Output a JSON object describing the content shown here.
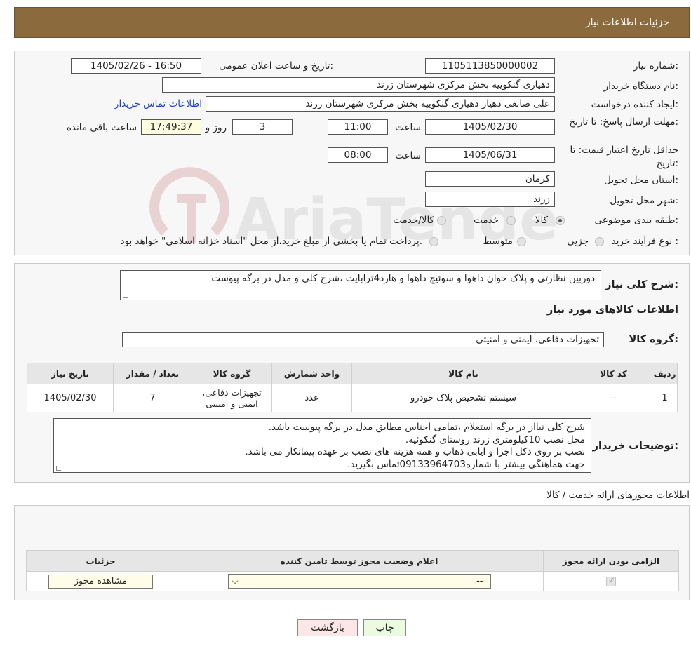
{
  "header": {
    "title": "جزئیات اطلاعات نیاز"
  },
  "form": {
    "need_number_label": "شماره نیاز:",
    "need_number": "1105113850000002",
    "announce_label": "تاریخ و ساعت اعلان عمومی:",
    "announce_value": "1405/02/26 - 16:50",
    "buyer_org_label": "نام دستگاه خریدار:",
    "buyer_org": "دهیاری گنکوییه بخش مرکزی شهرستان زرند",
    "requester_label": "ایجاد کننده درخواست:",
    "requester": "علی صانعی دهیار دهیاری گنکوییه بخش مرکزی شهرستان زرند",
    "contact_link": "اطلاعات تماس خریدار",
    "reply_deadline_label": "مهلت ارسال پاسخ: تا تاریخ:",
    "reply_date": "1405/02/30",
    "time_label": "ساعت",
    "reply_time": "11:00",
    "days_value": "3",
    "days_label": "روز و",
    "remaining_time": "17:49:37",
    "remaining_label": "ساعت باقی مانده",
    "price_validity_label": "حداقل تاریخ اعتبار قیمت: تا تاریخ:",
    "price_date": "1405/06/31",
    "price_time": "08:00",
    "province_label": "استان محل تحویل:",
    "province": "کرمان",
    "city_label": "شهر محل تحویل:",
    "city": "زرند",
    "category_label": "طبقه بندی موضوعی:",
    "category_options": [
      "کالا",
      "خدمت",
      "کالا/خدمت"
    ],
    "category_selected": "کالا",
    "process_label": "نوع فرآیند خرید :",
    "process_options": [
      "جزیی",
      "متوسط"
    ],
    "process_note": "پرداخت تمام یا بخشی از مبلغ خرید،از محل \"اسناد خزانه اسلامی\" خواهد بود."
  },
  "description": {
    "label": "شرح کلی نیاز:",
    "text": "دوربین نظارتی و پلاک خوان داهوا و سوئیچ داهوا  و هارد4ترابایت ،شرح کلی و مدل در برگه پیوست",
    "goods_info_title": "اطلاعات کالاهای مورد نیاز",
    "goods_group_label": "گروه کالا:",
    "goods_group": "تجهیزات دفاعی، ایمنی و امنیتی"
  },
  "goods_table": {
    "headers": [
      "ردیف",
      "کد کالا",
      "نام کالا",
      "واحد شمارش",
      "گروه کالا",
      "تعداد / مقدار",
      "تاریخ نیاز"
    ],
    "rows": [
      [
        "1",
        "--",
        "سیستم تشخیص پلاک خودرو",
        "عدد",
        "تجهیزات دفاعی، ایمنی و امنیتی",
        "7",
        "1405/02/30"
      ]
    ]
  },
  "buyer_notes": {
    "label": "توضیحات خریدار:",
    "lines": [
      "شرح کلی نیااز در برگه استعلام ،تمامی اجناس مطابق مدل در برگه پیوست باشد.",
      "محل نصب 10کیلومتری زرند روستای گنکوئیه.",
      "نصب بر روی دکل اجرا و ایابی ذهاب و همه هزینه های نصب بر عهده پیمانکار می باشد.",
      "جهت هماهنگی بیشتر با شماره09133964703تماس بگیرید."
    ]
  },
  "permits": {
    "title": "اطلاعات مجوزهای ارائه خدمت / کالا",
    "headers": [
      "الزامی بودن ارائه مجوز",
      "اعلام وضعیت مجوز توسط تامین کننده",
      "جزئیات"
    ],
    "select_value": "--",
    "view_button": "مشاهده مجوز"
  },
  "footer": {
    "print_label": "چاپ",
    "back_label": "بازگشت"
  },
  "watermark": {
    "text": "AriaTender.neT"
  },
  "colors": {
    "header_bg": "#8b6a3e",
    "link": "#1a3ec8",
    "print_bg": "#eafbe0",
    "back_bg": "#fde6e6",
    "remaining_bg": "#fffde0"
  }
}
